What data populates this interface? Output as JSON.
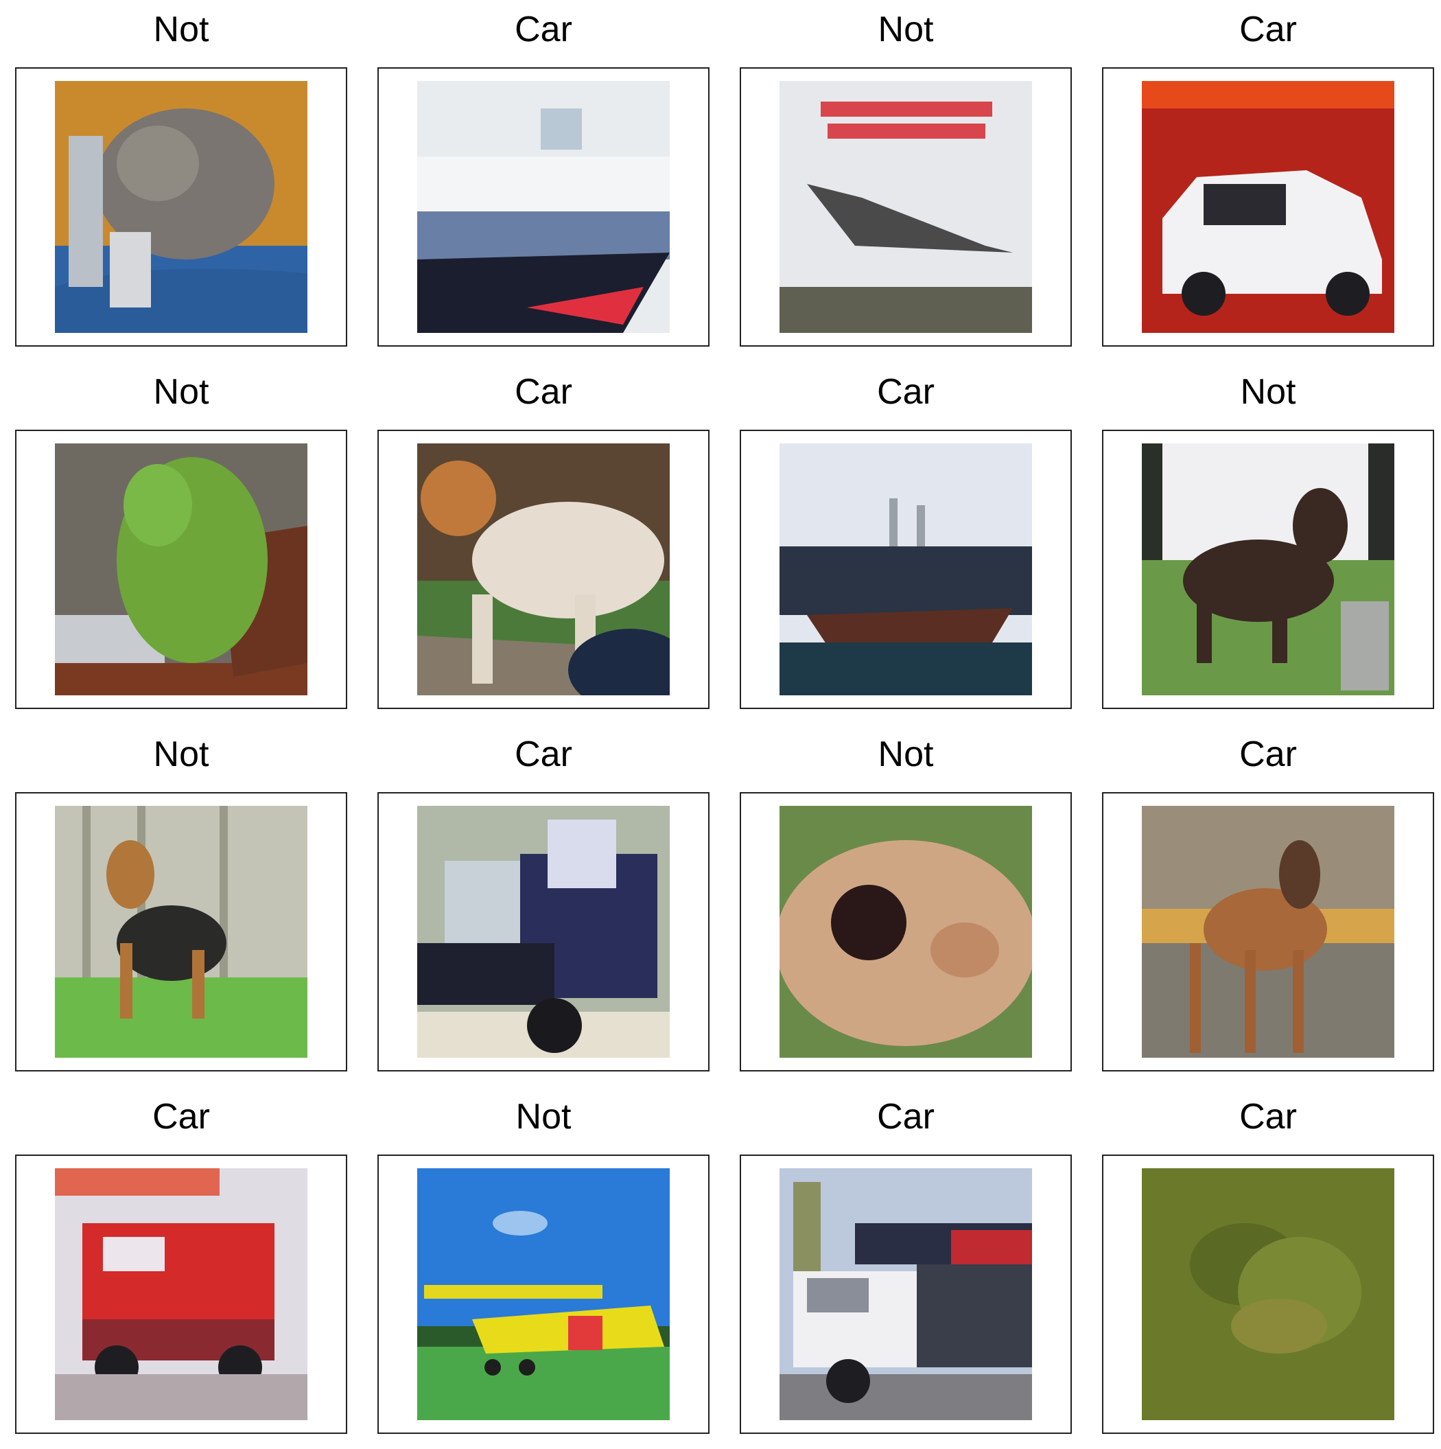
{
  "grid": {
    "cells": [
      {
        "label": "Not",
        "subject": "cat on blue blanket"
      },
      {
        "label": "Car",
        "subject": "white ship with red hull"
      },
      {
        "label": "Not",
        "subject": "concorde airplane poster"
      },
      {
        "label": "Car",
        "subject": "white car with open doors"
      },
      {
        "label": "Not",
        "subject": "green frog"
      },
      {
        "label": "Car",
        "subject": "white and brown dog"
      },
      {
        "label": "Car",
        "subject": "ship in harbor"
      },
      {
        "label": "Not",
        "subject": "dark horse on grass"
      },
      {
        "label": "Not",
        "subject": "terrier dog on grass"
      },
      {
        "label": "Car",
        "subject": "blue truck"
      },
      {
        "label": "Not",
        "subject": "fluffy dog face"
      },
      {
        "label": "Car",
        "subject": "deer standing"
      },
      {
        "label": "Car",
        "subject": "red fire truck"
      },
      {
        "label": "Not",
        "subject": "yellow biplane"
      },
      {
        "label": "Car",
        "subject": "white semi truck"
      },
      {
        "label": "Car",
        "subject": "frog on moss"
      }
    ]
  },
  "colors": {
    "frame_border": "#222222",
    "title_text": "#000000"
  }
}
